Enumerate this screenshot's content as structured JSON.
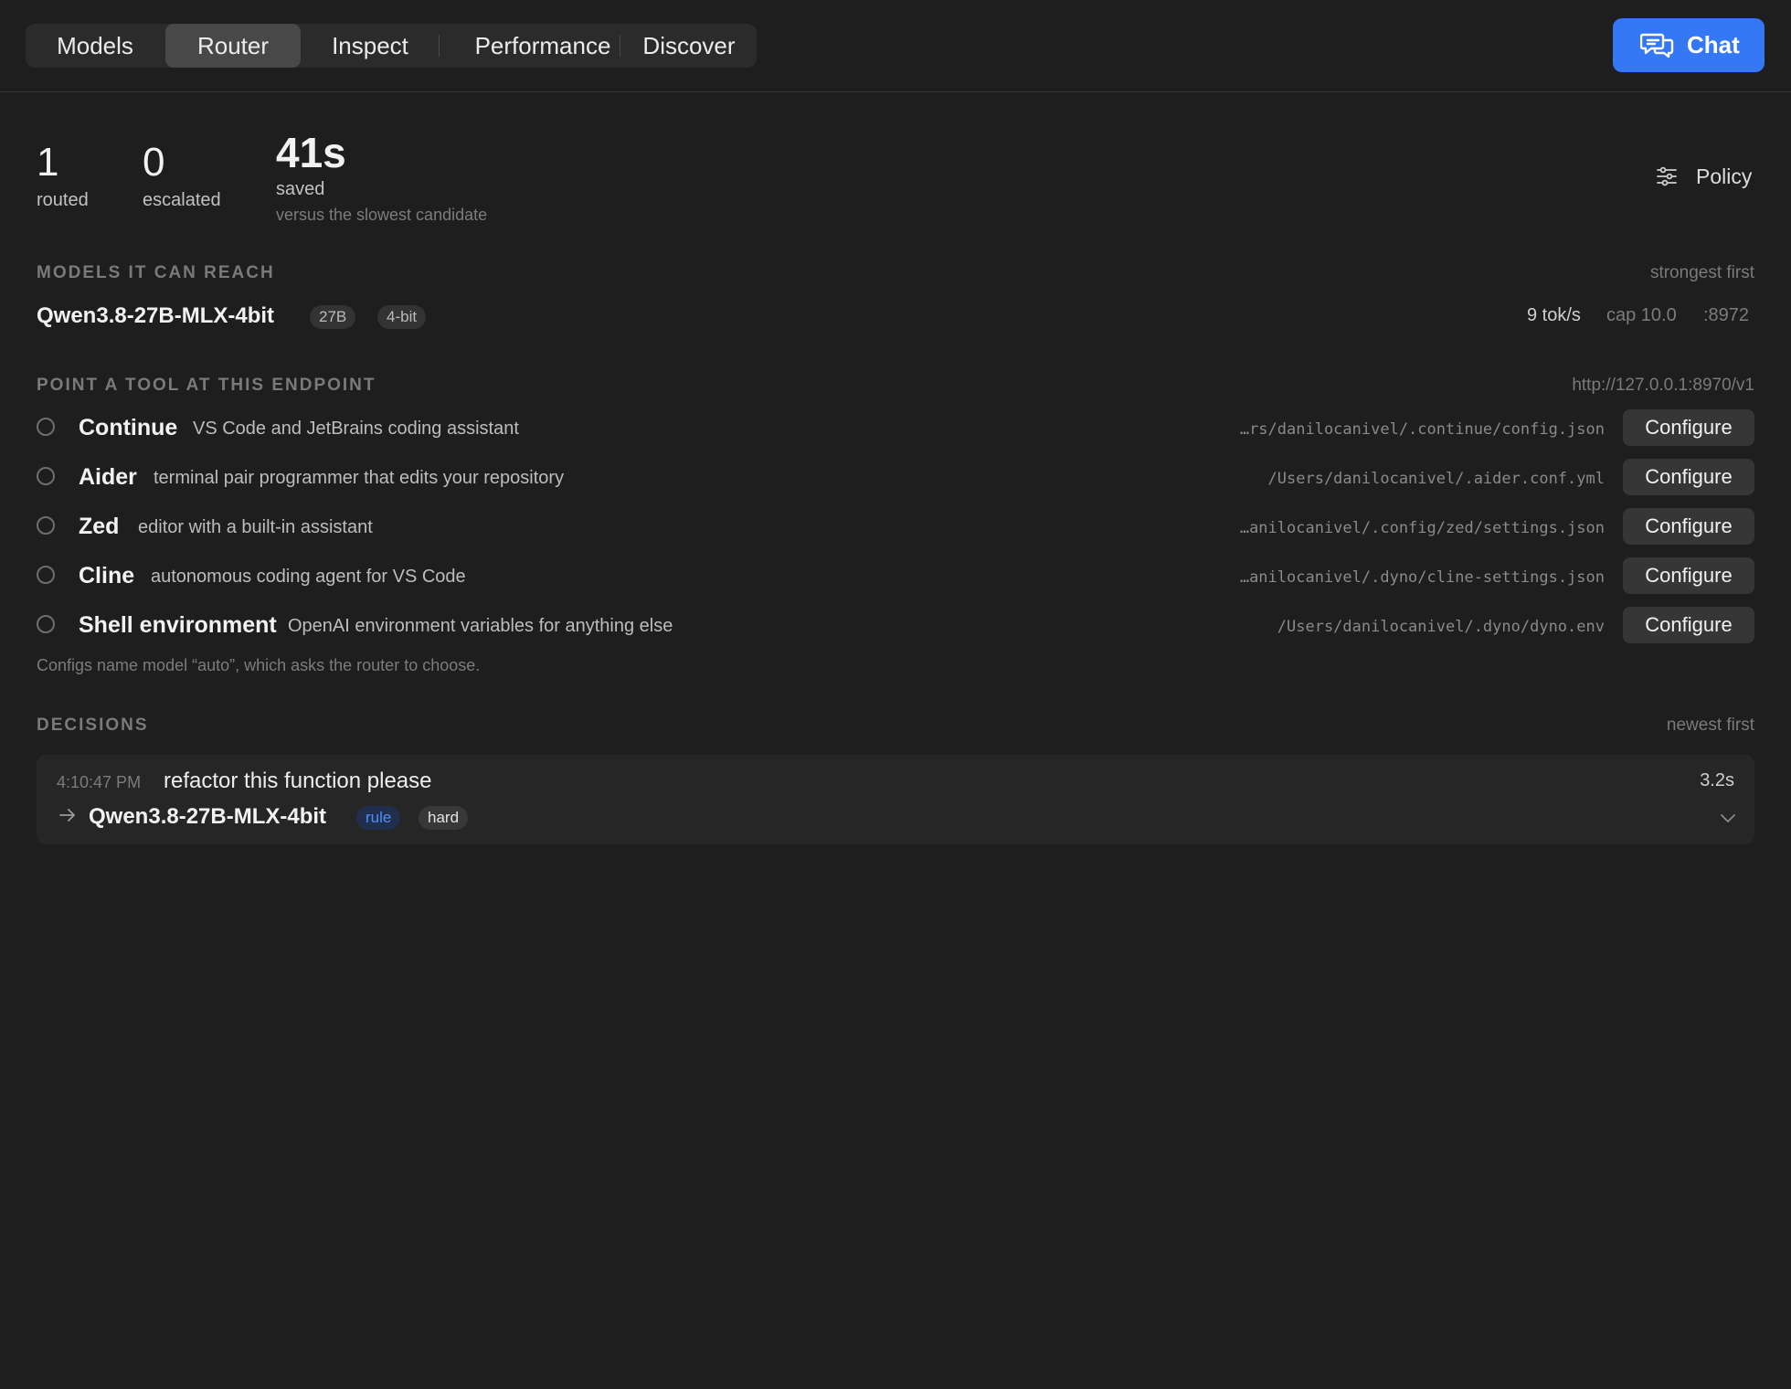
{
  "nav": {
    "tabs": [
      {
        "label": "Models",
        "active": false
      },
      {
        "label": "Router",
        "active": true
      },
      {
        "label": "Inspect",
        "active": false
      },
      {
        "label": "Performance",
        "active": false
      },
      {
        "label": "Discover",
        "active": false
      }
    ],
    "chat_label": "Chat",
    "chat_icon": "chat-bubbles-icon",
    "accent": "#3478f6"
  },
  "stats": {
    "routed": {
      "value": "1",
      "label": "routed"
    },
    "escalated": {
      "value": "0",
      "label": "escalated"
    },
    "saved": {
      "value": "41s",
      "label": "saved",
      "sub": "versus the slowest candidate"
    },
    "policy_label": "Policy",
    "policy_icon": "sliders-icon"
  },
  "models_section": {
    "title": "MODELS IT CAN REACH",
    "sort": "strongest first",
    "models": [
      {
        "name": "Qwen3.8-27B-MLX-4bit",
        "size": "27B",
        "quant": "4-bit",
        "speed": "9 tok/s",
        "cap": "cap 10.0",
        "port": ":8972"
      }
    ]
  },
  "endpoint_section": {
    "title": "POINT A TOOL AT THIS ENDPOINT",
    "url": "http://127.0.0.1:8970/v1",
    "configure_label": "Configure",
    "tools": [
      {
        "name": "Continue",
        "desc": "VS Code and JetBrains coding assistant",
        "path": "…rs/danilocanivel/.continue/config.json"
      },
      {
        "name": "Aider",
        "desc": "terminal pair programmer that edits your repository",
        "path": "/Users/danilocanivel/.aider.conf.yml"
      },
      {
        "name": "Zed",
        "desc": "editor with a built-in assistant",
        "path": "…anilocanivel/.config/zed/settings.json"
      },
      {
        "name": "Cline",
        "desc": "autonomous coding agent for VS Code",
        "path": "…anilocanivel/.dyno/cline-settings.json"
      },
      {
        "name": "Shell environment",
        "desc": "OpenAI environment variables for anything else",
        "path": "/Users/danilocanivel/.dyno/dyno.env"
      }
    ],
    "note": "Configs name model “auto”, which asks the router to choose."
  },
  "decisions_section": {
    "title": "DECISIONS",
    "sort": "newest first",
    "items": [
      {
        "time": "4:10:47 PM",
        "prompt": "refactor this function please",
        "duration": "3.2s",
        "model": "Qwen3.8-27B-MLX-4bit",
        "tags": [
          "rule",
          "hard"
        ],
        "rule_color": "#4f8ff7"
      }
    ]
  }
}
